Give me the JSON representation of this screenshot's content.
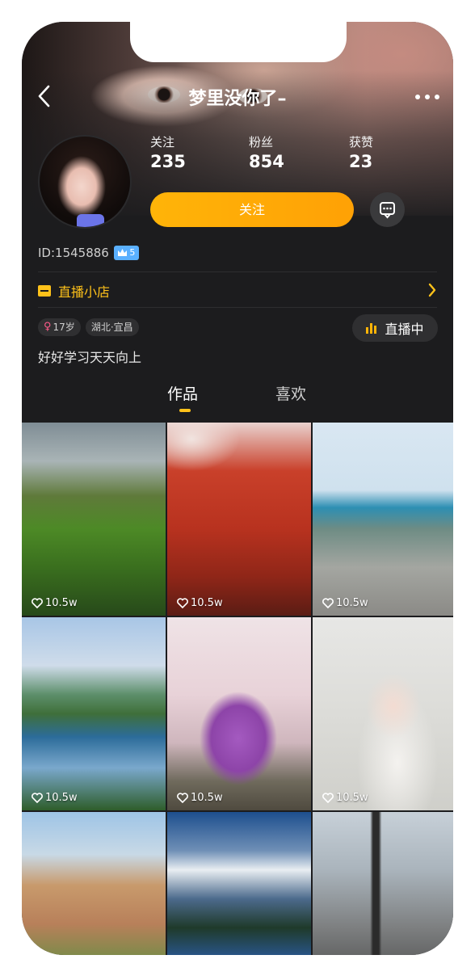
{
  "header": {
    "title": "梦里没你了–",
    "back_icon": "chevron-left-icon",
    "more_icon": "more-dots-icon"
  },
  "stats": [
    {
      "label": "关注",
      "value": "235"
    },
    {
      "label": "粉丝",
      "value": "854"
    },
    {
      "label": "获赞",
      "value": "23"
    }
  ],
  "actions": {
    "follow_label": "关注",
    "message_icon": "message-icon"
  },
  "profile": {
    "id_text": "ID:1545886",
    "vip_level": "5",
    "shop_label": "直播小店",
    "tags": {
      "age": "17岁",
      "location": "湖北·宜昌"
    },
    "live_label": "直播中",
    "bio": "好好学习天天向上"
  },
  "tabs": [
    {
      "label": "作品",
      "active": true
    },
    {
      "label": "喜欢",
      "active": false
    }
  ],
  "grid": {
    "items": [
      {
        "likes": "10.5w"
      },
      {
        "likes": "10.5w"
      },
      {
        "likes": "10.5w"
      },
      {
        "likes": "10.5w"
      },
      {
        "likes": "10.5w"
      },
      {
        "likes": "10.5w"
      },
      {
        "likes": ""
      },
      {
        "likes": ""
      },
      {
        "likes": ""
      }
    ]
  },
  "colors": {
    "accent": "#ffb408",
    "shop": "#ffc21a",
    "background": "#1c1c1e"
  }
}
